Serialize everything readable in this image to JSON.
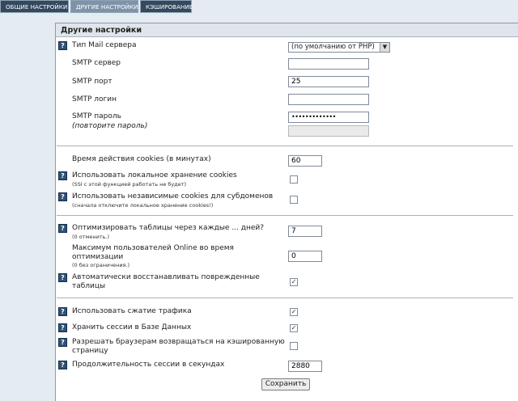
{
  "tabs": [
    {
      "label": "ОБЩИЕ НАСТРОЙКИ"
    },
    {
      "label": "ДРУГИЕ НАСТРОЙКИ"
    },
    {
      "label": "КЭШИРОВАНИЕ"
    }
  ],
  "panel": {
    "title": "Другие настройки"
  },
  "help_icon": "?",
  "mail": {
    "type_label": "Тип Mail сервера",
    "type_value": "(по умолчанию от PHP)",
    "smtp_server_label": "SMTP сервер",
    "smtp_server_value": "",
    "smtp_port_label": "SMTP порт",
    "smtp_port_value": "25",
    "smtp_login_label": "SMTP логин",
    "smtp_login_value": "",
    "smtp_password_label": "SMTP пароль",
    "smtp_password_value": "•••••••••••••",
    "repeat_password_label": "(повторите пароль)"
  },
  "cookies": {
    "lifetime_label": "Время действия cookies (в минутах)",
    "lifetime_value": "60",
    "local_label": "Использовать локальное хранение cookies",
    "local_note": "(SSI с этой функцией работать не будет)",
    "local_checked": false,
    "subdomain_label": "Использовать независимые cookies для субдоменов",
    "subdomain_note": "(сначала отключите локальное хранение cookies!)",
    "subdomain_checked": false
  },
  "optimize": {
    "tables_label": "Оптимизировать таблицы через каждые ... дней?",
    "tables_note": "(0 отменить.)",
    "tables_value": "7",
    "max_users_label_1": "Максимум пользователей Online во время",
    "max_users_label_2": "оптимизации",
    "max_users_note": "(0 без ограничения.)",
    "max_users_value": "0",
    "auto_repair_label_1": "Автоматически восстанавливать поврежденные",
    "auto_repair_label_2": "таблицы",
    "auto_repair_checked": true
  },
  "session": {
    "compress_label": "Использовать сжатие трафика",
    "compress_checked": true,
    "db_label": "Хранить сессии в Базе Данных",
    "db_checked": true,
    "back_label_1": "Разрешать браузерам возвращаться на кэшированную",
    "back_label_2": "страницу",
    "back_checked": false,
    "duration_label": "Продолжительность сессии в секундах",
    "duration_value": "2880"
  },
  "buttons": {
    "save": "Сохранить"
  },
  "colors": {
    "tab_bg": "#33495e",
    "tab_active": "#7f93a8",
    "page_bg": "#e4ebf1",
    "help_icon": "#2f5277"
  }
}
